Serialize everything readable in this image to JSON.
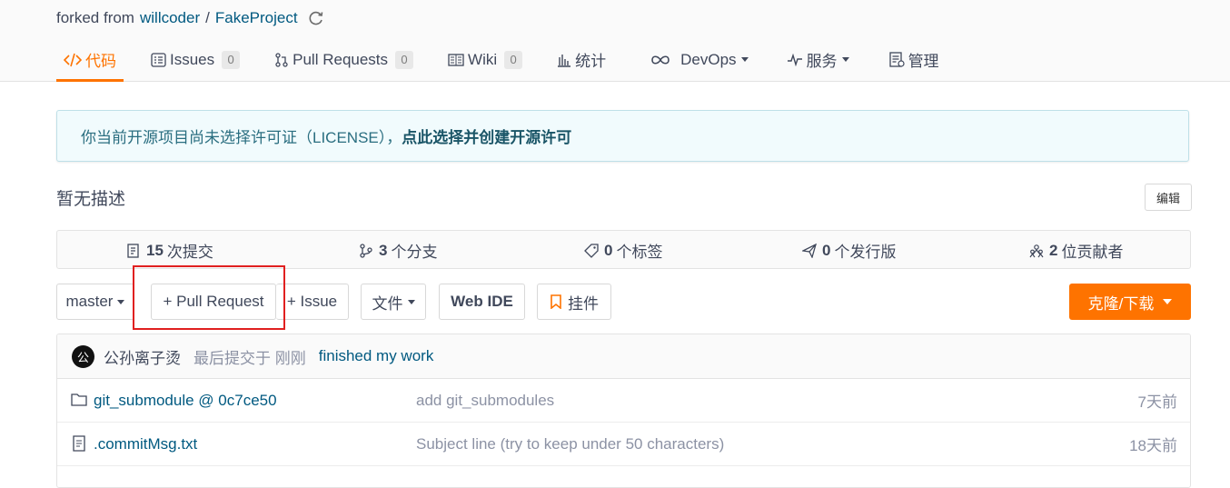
{
  "header": {
    "forked_prefix": "forked from",
    "owner": "willcoder",
    "separator": "/",
    "repo": "FakeProject"
  },
  "tabs": [
    {
      "label": "代码",
      "icon": "code-icon",
      "active": true
    },
    {
      "label": "Issues",
      "count": "0",
      "icon": "issues-icon"
    },
    {
      "label": "Pull Requests",
      "count": "0",
      "icon": "pull-request-icon"
    },
    {
      "label": "Wiki",
      "count": "0",
      "icon": "wiki-icon"
    },
    {
      "label": "统计",
      "icon": "stats-icon"
    },
    {
      "label": "DevOps",
      "icon": "infinity-icon",
      "dropdown": true
    },
    {
      "label": "服务",
      "icon": "pulse-icon",
      "dropdown": true
    },
    {
      "label": "管理",
      "icon": "manage-icon"
    }
  ],
  "notice": {
    "text": "你当前开源项目尚未选择许可证（LICENSE），",
    "link": "点此选择并创建开源许可"
  },
  "description": {
    "text": "暂无描述",
    "edit_label": "编辑"
  },
  "stats": [
    {
      "count": "15",
      "label": "次提交",
      "icon": "commit-icon"
    },
    {
      "count": "3",
      "label": "个分支",
      "icon": "branch-icon"
    },
    {
      "count": "0",
      "label": "个标签",
      "icon": "tag-icon"
    },
    {
      "count": "0",
      "label": "个发行版",
      "icon": "release-icon"
    },
    {
      "count": "2",
      "label": "位贡献者",
      "icon": "contributors-icon"
    }
  ],
  "toolbar": {
    "branch": "master",
    "pull_request": "+ Pull Request",
    "issue": "+ Issue",
    "files": "文件",
    "web_ide": "Web IDE",
    "widget": "挂件",
    "clone": "克隆/下载"
  },
  "commit": {
    "avatar_char": "公",
    "author": "公孙离子烫",
    "when": "最后提交于 刚刚",
    "message": "finished my work"
  },
  "files": [
    {
      "name": "git_submodule @ 0c7ce50",
      "message": "add git_submodules",
      "time": "7天前",
      "icon": "folder-icon"
    },
    {
      "name": ".commitMsg.txt",
      "message": "Subject line (try to keep under 50 characters)",
      "time": "18天前",
      "icon": "file-icon"
    }
  ],
  "colors": {
    "accent": "#fe7300",
    "link": "#005980",
    "highlight_box": "#e02020"
  }
}
